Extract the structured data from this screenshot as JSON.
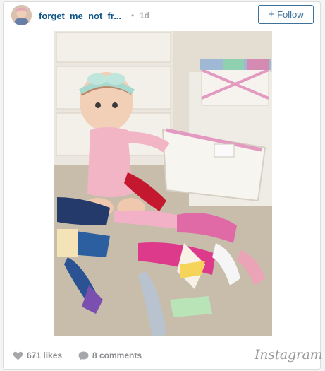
{
  "post": {
    "username": "forget_me_not_fr...",
    "separator": "•",
    "time_ago": "1d",
    "follow_label": "Follow",
    "likes": "671 likes",
    "comments": "8 comments",
    "brand": "Instagram"
  },
  "icons": {
    "avatar": "profile-avatar",
    "follow": "plus-icon",
    "likes": "heart-icon",
    "comments": "speech-bubble-icon"
  },
  "colors": {
    "username": "#125688",
    "follow_border": "#3f729b",
    "meta_gray": "#8a8c8f"
  }
}
